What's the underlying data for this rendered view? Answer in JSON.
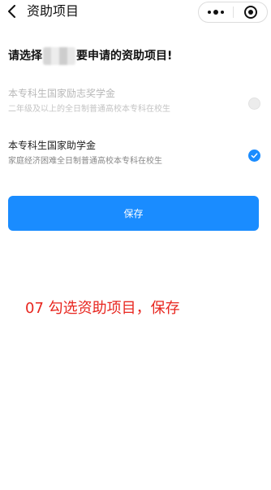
{
  "nav": {
    "title": "资助项目",
    "back_icon": "chevron-left-icon",
    "more_icon": "more-dots-icon",
    "close_icon": "target-circle-icon"
  },
  "heading": {
    "prefix": "请选择",
    "suffix": "要申请的资助项目!"
  },
  "options": [
    {
      "title": "本专科生国家励志奖学金",
      "subtitle": "二年级及以上的全日制普通高校本专科在校生",
      "selected": false,
      "enabled": false
    },
    {
      "title": "本专科生国家助学金",
      "subtitle": "家庭经济困难全日制普通高校本专科在校生",
      "selected": true,
      "enabled": true
    }
  ],
  "save_button": {
    "label": "保存"
  },
  "annotation": {
    "text": "07 勾选资助项目，保存"
  },
  "colors": {
    "accent": "#1a8cff",
    "annotation": "#e8261f",
    "disabled_text": "#b8b8b8"
  }
}
